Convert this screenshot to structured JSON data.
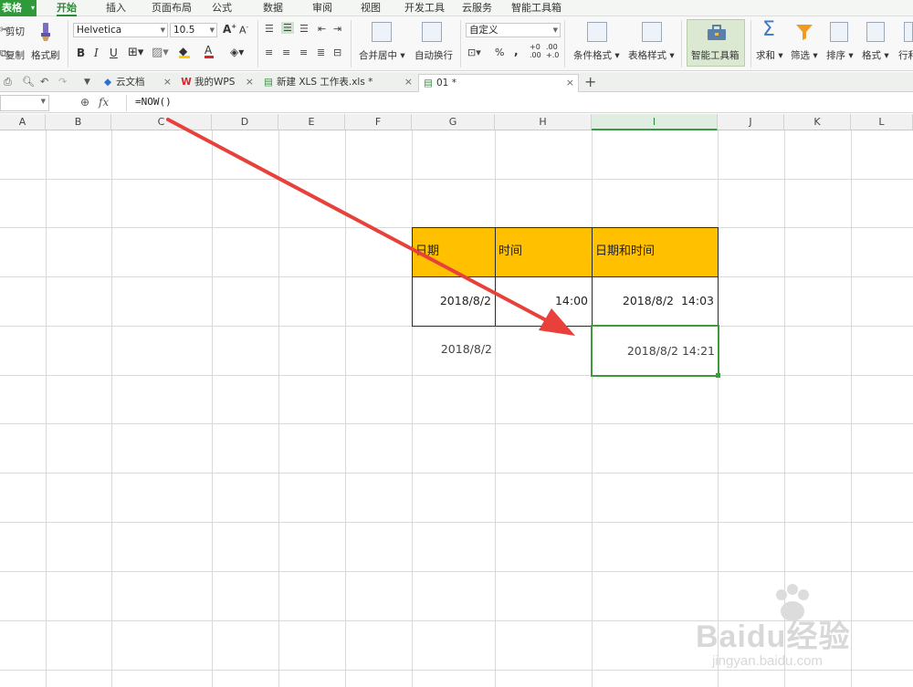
{
  "app": {
    "name": "表格"
  },
  "menu": [
    "开始",
    "插入",
    "页面布局",
    "公式",
    "数据",
    "审阅",
    "视图",
    "开发工具",
    "云服务",
    "智能工具箱"
  ],
  "ribbon": {
    "cut": "剪切",
    "copy": "复制",
    "format_painter": "格式刷",
    "font_name": "Helvetica",
    "font_size": "10.5",
    "bold": "B",
    "italic": "I",
    "underline": "U",
    "merge_center": "合并居中",
    "wrap_text": "自动换行",
    "number_format": "自定义",
    "percent": "%",
    "comma": ",",
    "inc_decimal": "+0\n.00",
    "dec_decimal": ".00\n+.0",
    "conditional_format": "条件格式",
    "table_style": "表格样式",
    "smart_toolbox": "智能工具箱",
    "sum": "求和",
    "filter": "筛选",
    "sort": "排序",
    "format": "格式",
    "rows_cols": "行和"
  },
  "tabs": [
    {
      "label": "云文档"
    },
    {
      "label": "我的WPS"
    },
    {
      "label": "新建 XLS 工作表.xls *"
    },
    {
      "label": "01 *"
    }
  ],
  "formula_bar": {
    "fx": "fx",
    "formula": "=NOW()"
  },
  "columns": [
    "A",
    "B",
    "C",
    "D",
    "E",
    "F",
    "G",
    "H",
    "I",
    "J",
    "K",
    "L"
  ],
  "selected_column": "I",
  "table": {
    "headers": [
      "日期",
      "时间",
      "日期和时间"
    ],
    "row1": [
      "2018/8/2",
      "14:00",
      "2018/8/2  14:03"
    ],
    "row2": [
      "2018/8/2",
      "",
      "2018/8/2 14:21"
    ]
  },
  "colors": {
    "accent": "#2a8a36",
    "header_fill": "#ffc000",
    "arrow": "#e8403a",
    "selection": "#3f9a3a"
  },
  "watermark": {
    "brand": "Baidu经验",
    "url": "jingyan.baidu.com"
  }
}
